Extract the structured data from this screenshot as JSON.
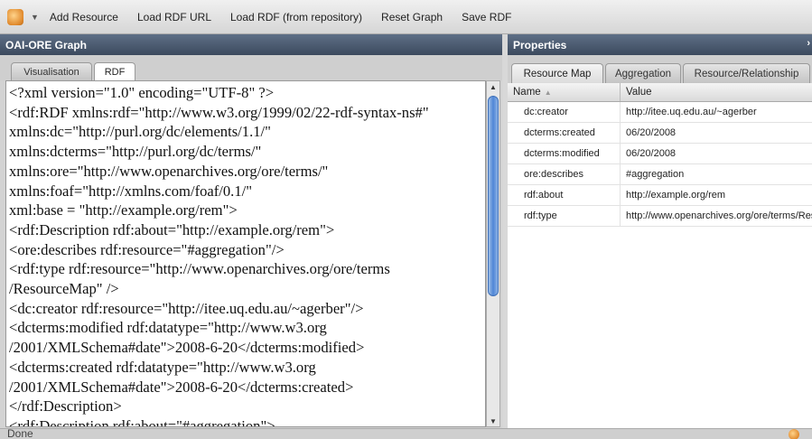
{
  "menubar": {
    "app_icon": "app-logo-icon",
    "items": [
      "Add Resource",
      "Load RDF URL",
      "Load RDF (from repository)",
      "Reset Graph",
      "Save RDF"
    ]
  },
  "left_panel": {
    "title": "OAI-ORE Graph",
    "tabs": [
      "Visualisation",
      "RDF"
    ],
    "active_tab": "RDF",
    "code_lines": [
      "<?xml version=\"1.0\" encoding=\"UTF-8\" ?>",
      "<rdf:RDF xmlns:rdf=\"http://www.w3.org/1999/02/22-rdf-syntax-ns#\"",
      "xmlns:dc=\"http://purl.org/dc/elements/1.1/\"",
      "xmlns:dcterms=\"http://purl.org/dc/terms/\"",
      "xmlns:ore=\"http://www.openarchives.org/ore/terms/\"",
      "xmlns:foaf=\"http://xmlns.com/foaf/0.1/\"",
      "xml:base = \"http://example.org/rem\">",
      "<rdf:Description rdf:about=\"http://example.org/rem\">",
      "<ore:describes rdf:resource=\"#aggregation\"/>",
      "<rdf:type rdf:resource=\"http://www.openarchives.org/ore/terms",
      "/ResourceMap\" />",
      "<dc:creator rdf:resource=\"http://itee.uq.edu.au/~agerber\"/>",
      "<dcterms:modified rdf:datatype=\"http://www.w3.org",
      "/2001/XMLSchema#date\">2008-6-20</dcterms:modified>",
      "<dcterms:created rdf:datatype=\"http://www.w3.org",
      "/2001/XMLSchema#date\">2008-6-20</dcterms:created>",
      "</rdf:Description>",
      "<rdf:Description rdf:about=\"#aggregation\">"
    ]
  },
  "right_panel": {
    "title": "Properties",
    "close_icon": "close-icon",
    "tabs": [
      "Resource Map",
      "Aggregation",
      "Resource/Relationship"
    ],
    "active_tab": "Resource Map",
    "columns": [
      "Name",
      "Value"
    ],
    "rows": [
      {
        "name": "dc:creator",
        "value": "http://itee.uq.edu.au/~agerber"
      },
      {
        "name": "dcterms:created",
        "value": "06/20/2008"
      },
      {
        "name": "dcterms:modified",
        "value": "06/20/2008"
      },
      {
        "name": "ore:describes",
        "value": "#aggregation"
      },
      {
        "name": "rdf:about",
        "value": "http://example.org/rem"
      },
      {
        "name": "rdf:type",
        "value": "http://www.openarchives.org/ore/terms/ResourceMap"
      }
    ]
  },
  "status": {
    "text": "Done"
  }
}
